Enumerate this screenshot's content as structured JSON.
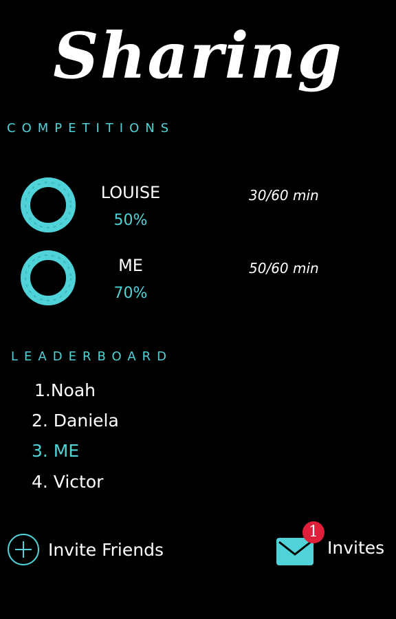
{
  "page": {
    "title": "Sharing"
  },
  "competitions": {
    "label": "COMPETITIONS",
    "items": [
      {
        "name": "LOUISE",
        "percent": "50%",
        "minutes": "30/60 min",
        "progress": 0.5
      },
      {
        "name": "ME",
        "percent": "70%",
        "minutes": "50/60 min",
        "progress": 0.7
      }
    ]
  },
  "leaderboard": {
    "label": "LEADERBOARD",
    "items": [
      {
        "text": "1.Noah"
      },
      {
        "text": "2. Daniela"
      },
      {
        "text": "3. ME",
        "highlight": true
      },
      {
        "text": "4. Victor"
      }
    ]
  },
  "actions": {
    "invite_friends_label": "Invite Friends",
    "invites_label": "Invites",
    "invites_badge": "1"
  },
  "colors": {
    "accent": "#4fd3d9",
    "badge": "#e0203b",
    "background": "#000000"
  },
  "icons": {
    "plus": "plus-circle-icon",
    "mail": "envelope-icon"
  }
}
